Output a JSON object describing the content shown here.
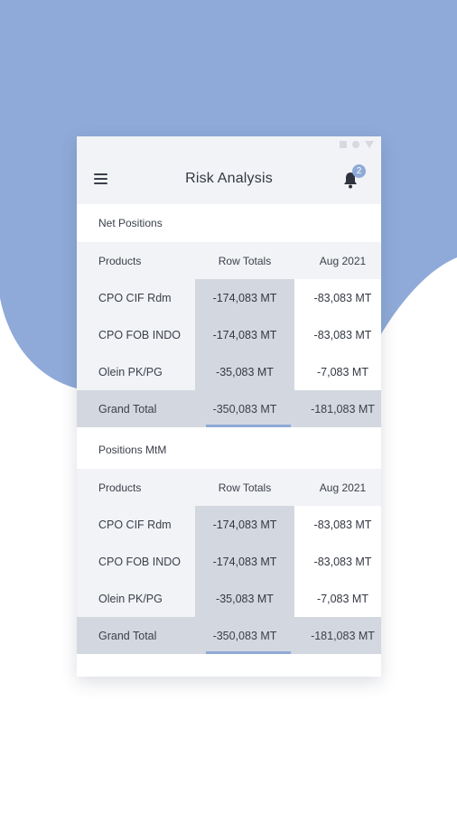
{
  "app": {
    "title": "Risk Analysis",
    "notification_count": "2"
  },
  "colors": {
    "accent": "#8FAAD8",
    "header_bg": "#F2F3F6",
    "highlight_col": "#D3D8E0"
  },
  "sections": [
    {
      "title": "Net Positions",
      "columns": [
        "Products",
        "Row Totals",
        "Aug 2021"
      ],
      "rows": [
        {
          "product": "CPO CIF Rdm",
          "row_total": "-174,083 MT",
          "aug": "-83,083 MT"
        },
        {
          "product": "CPO FOB INDO",
          "row_total": "-174,083 MT",
          "aug": "-83,083 MT"
        },
        {
          "product": "Olein PK/PG",
          "row_total": "-35,083 MT",
          "aug": "-7,083 MT"
        }
      ],
      "total": {
        "label": "Grand Total",
        "row_total": "-350,083 MT",
        "aug": "-181,083 MT"
      }
    },
    {
      "title": "Positions MtM",
      "columns": [
        "Products",
        "Row Totals",
        "Aug 2021"
      ],
      "rows": [
        {
          "product": "CPO CIF Rdm",
          "row_total": "-174,083 MT",
          "aug": "-83,083 MT"
        },
        {
          "product": "CPO FOB INDO",
          "row_total": "-174,083 MT",
          "aug": "-83,083 MT"
        },
        {
          "product": "Olein PK/PG",
          "row_total": "-35,083 MT",
          "aug": "-7,083 MT"
        }
      ],
      "total": {
        "label": "Grand Total",
        "row_total": "-350,083 MT",
        "aug": "-181,083 MT"
      }
    }
  ]
}
